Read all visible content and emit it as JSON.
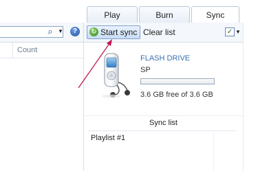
{
  "tabs": [
    {
      "label": "Play"
    },
    {
      "label": "Burn"
    },
    {
      "label": "Sync"
    }
  ],
  "search": {
    "placeholder": ""
  },
  "help": {
    "glyph": "?"
  },
  "list_columns": {
    "count": "Count"
  },
  "toolbar": {
    "start_sync_label": "Start sync",
    "clear_list_label": "Clear list"
  },
  "device": {
    "name": "FLASH DRIVE",
    "sub": "SP",
    "capacity_text": "3.6 GB free of 3.6 GB",
    "used_fraction": 0
  },
  "sync_list": {
    "title": "Sync list",
    "items": [
      {
        "label": "Playlist #1"
      }
    ]
  },
  "colors": {
    "accent": "#3a6fae",
    "annotation_arrow": "#c0174f"
  }
}
